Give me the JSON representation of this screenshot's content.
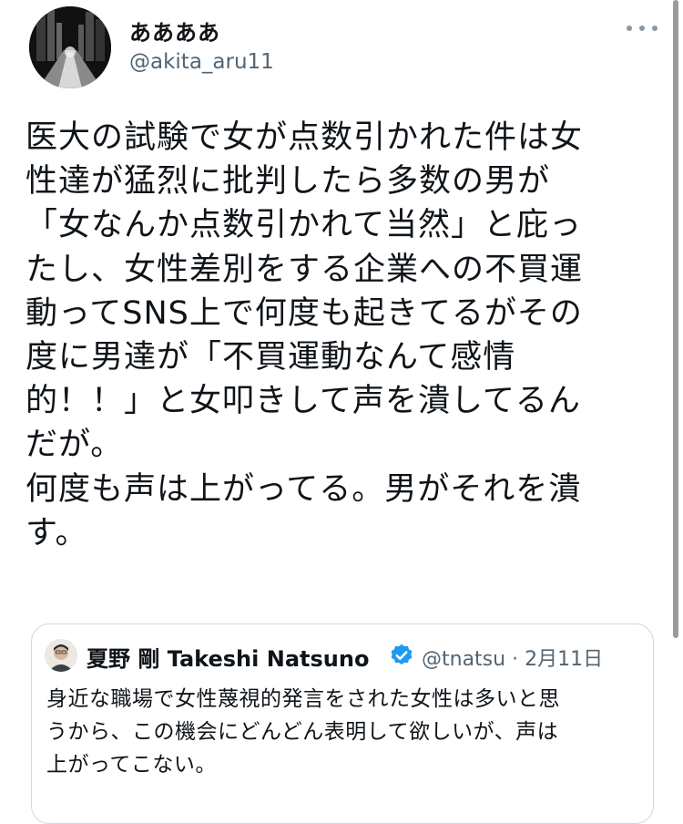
{
  "author": {
    "display_name": "ああああ",
    "handle": "@akita_aru11"
  },
  "tweet": {
    "text": "医大の試験で女が点数引かれた件は女\n性達が猛烈に批判したら多数の男が\n「女なんか点数引かれて当然」と庇っ\nたし、女性差別をする企業への不買運\n動ってSNS上で何度も起きてるがその\n度に男達が「不買運動なんて感情\n的！！」と女叩きして声を潰してるん\nだが。\n何度も声は上がってる。男がそれを潰\nす。"
  },
  "quoted_tweet": {
    "name": "夏野 剛 Takeshi Natsuno",
    "handle": "@tnatsu",
    "separator": "·",
    "date": "2月11日",
    "text": "身近な職場で女性蔑視的発言をされた女性は多いと思\nうから、この機会にどんどん表明して欲しいが、声は\n上がってこない。"
  },
  "icons": {
    "more": "more-horizontal-icon",
    "verified": "verified-badge-icon"
  },
  "colors": {
    "text": "#0f1419",
    "secondary": "#536471",
    "verified": "#1d9bf0",
    "border": "#cfd9de"
  }
}
